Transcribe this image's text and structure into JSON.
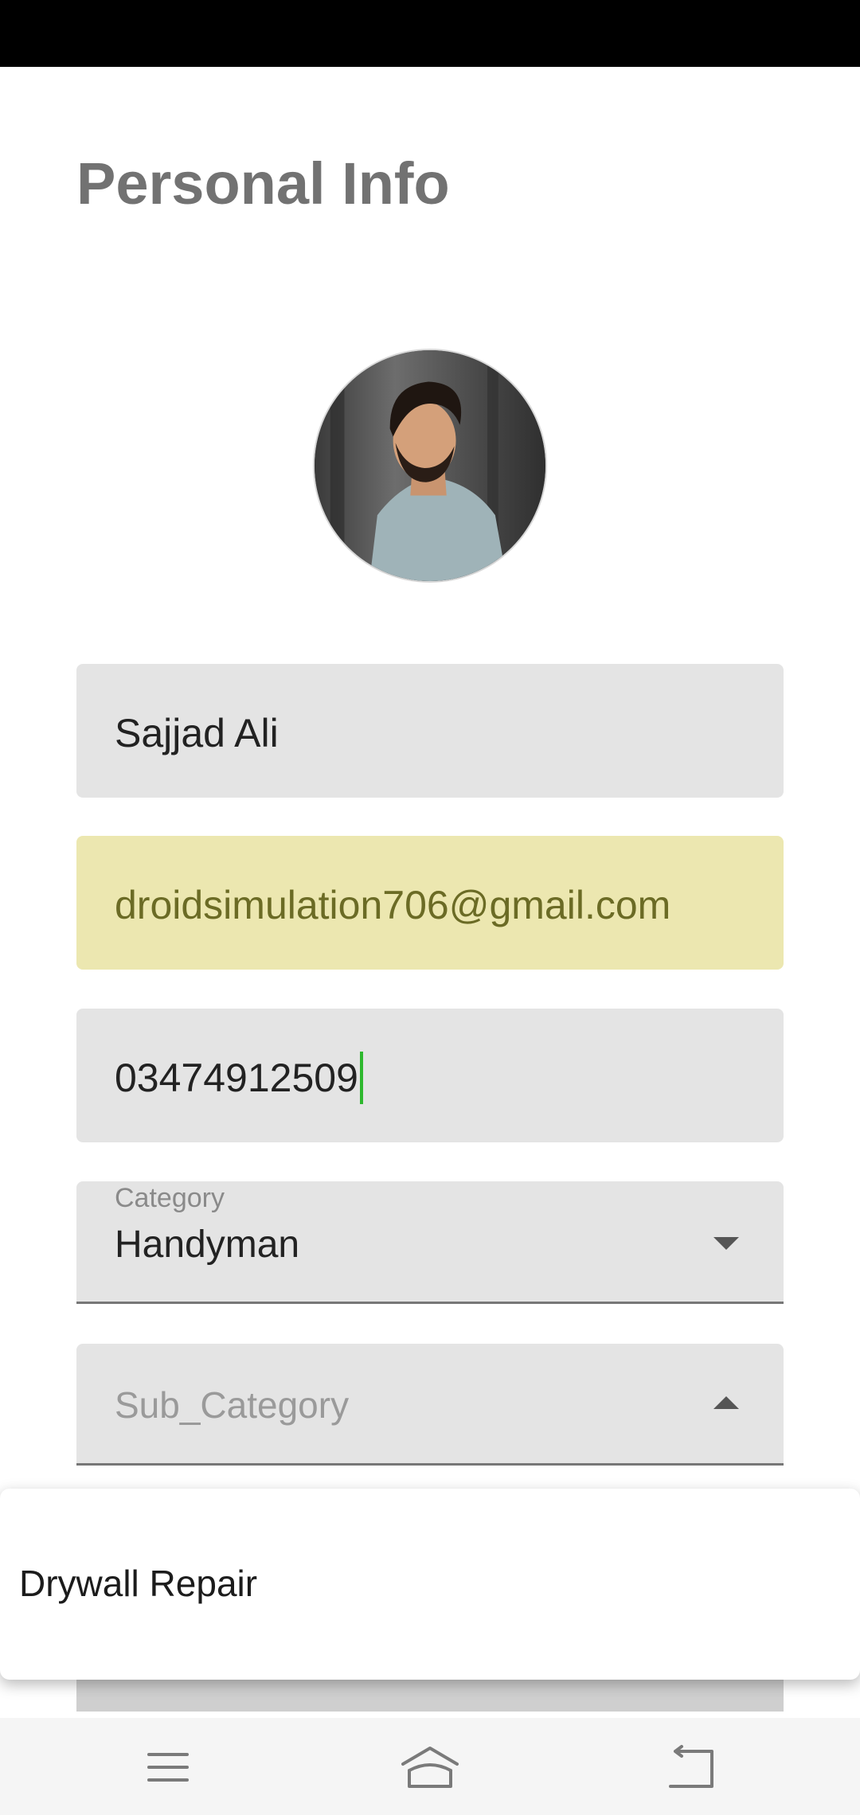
{
  "page": {
    "title": "Personal Info"
  },
  "profile": {
    "name": "Sajjad Ali",
    "email": "droidsimulation706@gmail.com",
    "phone": "03474912509"
  },
  "category": {
    "label": "Category",
    "value": "Handyman"
  },
  "sub_category": {
    "placeholder": "Sub_Category",
    "options": [
      "Drywall Repair"
    ]
  },
  "icons": {
    "category_arrow": "triangle-down-icon",
    "sub_category_arrow": "triangle-up-icon",
    "nav_menu": "menu-icon",
    "nav_home": "home-icon",
    "nav_back": "back-icon"
  },
  "colors": {
    "autofill": "#ece7b0",
    "caret": "#2eb82e",
    "field_bg": "#e4e4e4"
  }
}
